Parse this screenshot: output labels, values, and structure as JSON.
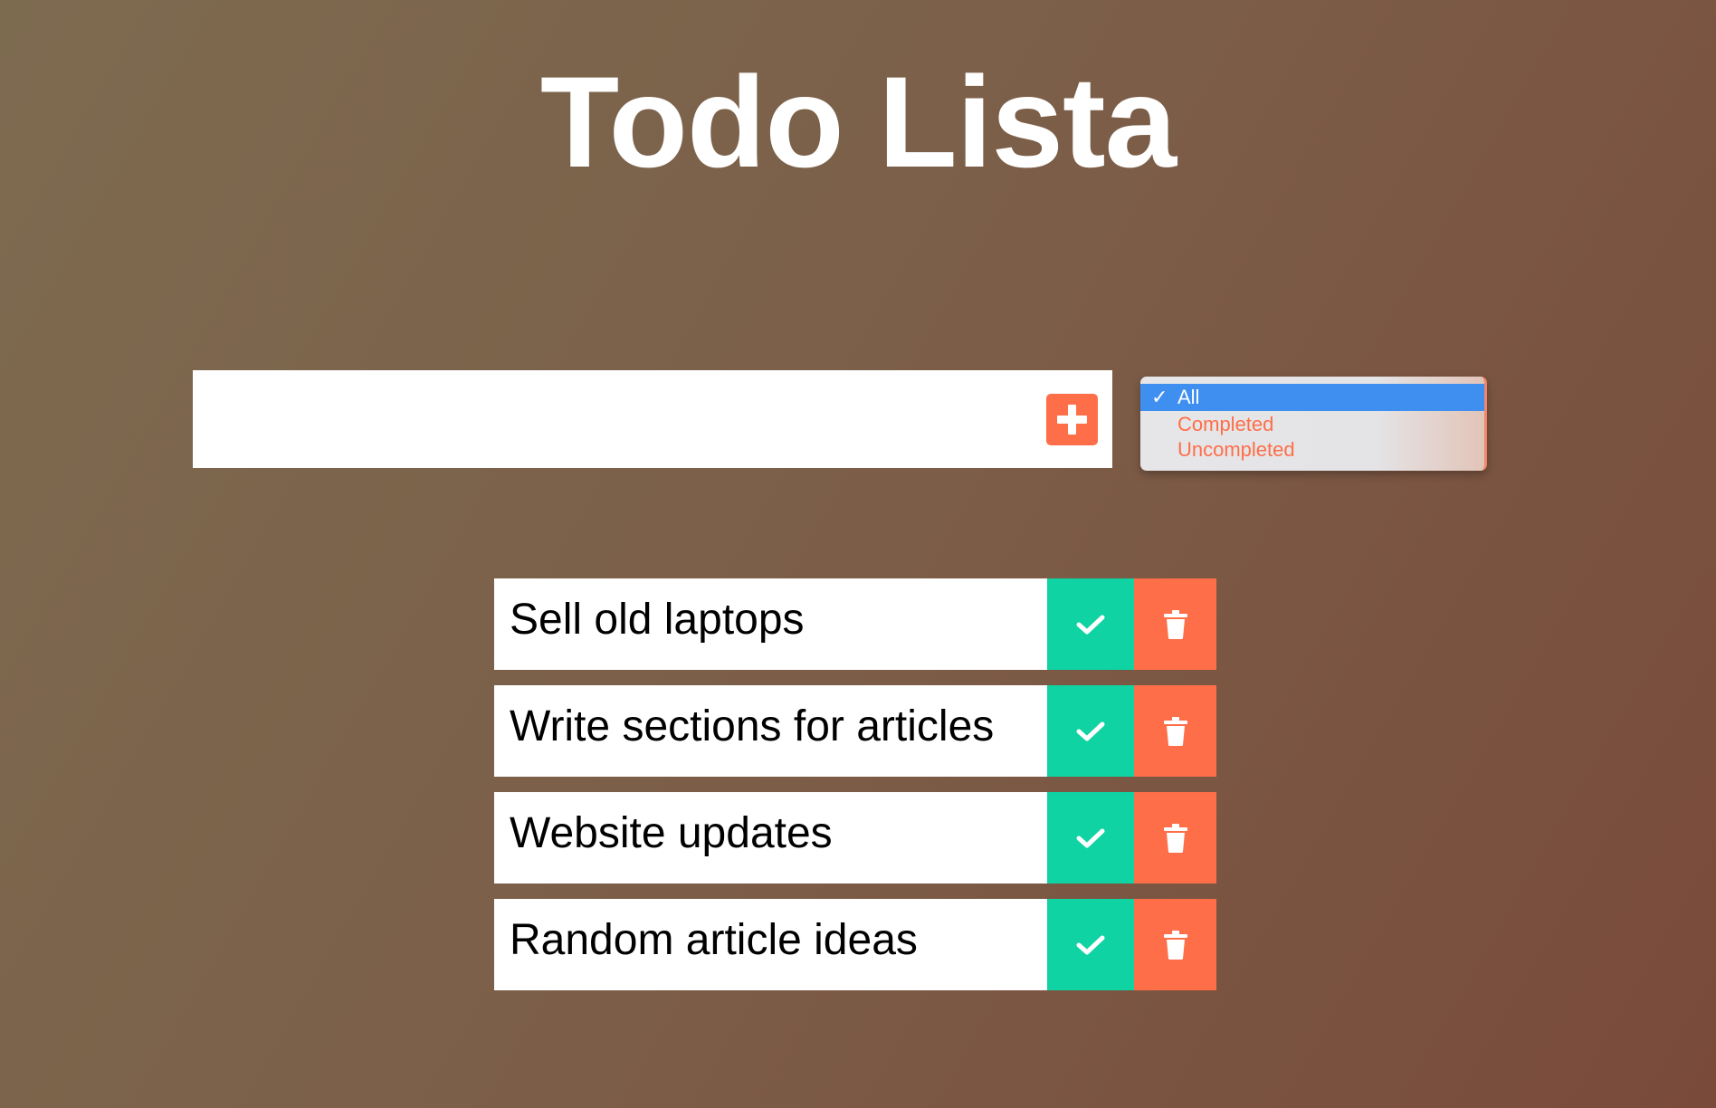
{
  "header": {
    "title": "Todo Lista"
  },
  "form": {
    "input_value": "",
    "add_icon": "plus-icon"
  },
  "filter": {
    "options": [
      {
        "label": "All",
        "selected": true
      },
      {
        "label": "Completed",
        "selected": false
      },
      {
        "label": "Uncompleted",
        "selected": false
      }
    ],
    "check_glyph": "✓"
  },
  "todos": [
    {
      "text": "Sell old laptops"
    },
    {
      "text": "Write sections for articles"
    },
    {
      "text": "Website updates"
    },
    {
      "text": "Random article ideas"
    }
  ],
  "colors": {
    "accent": "#fe6e49",
    "complete": "#0fd3a3",
    "selected": "#3e8ff0"
  },
  "icons": {
    "complete": "check-icon",
    "delete": "trash-icon"
  }
}
